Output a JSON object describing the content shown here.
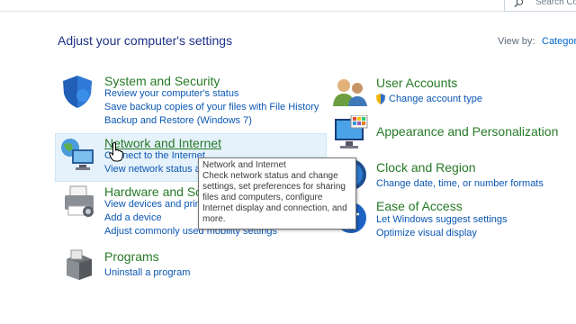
{
  "search": {
    "placeholder": "Search Co"
  },
  "header": {
    "title": "Adjust your computer's settings",
    "view_by_label": "View by:",
    "view_by_value": "Category"
  },
  "categories_left": [
    {
      "title": "System and Security",
      "icon": "shield-icon",
      "links": [
        "Review your computer's status",
        "Save backup copies of your files with File History",
        "Backup and Restore (Windows 7)"
      ]
    },
    {
      "title": "Network and Internet",
      "icon": "network-globe-icon",
      "links": [
        "Connect to the Internet",
        "View network status and tasks"
      ]
    },
    {
      "title": "Hardware and Sound",
      "icon": "printer-icon",
      "links": [
        "View devices and printers",
        "Add a device",
        "Adjust commonly used mobility settings"
      ]
    },
    {
      "title": "Programs",
      "icon": "programs-box-icon",
      "links": [
        "Uninstall a program"
      ]
    }
  ],
  "categories_right": [
    {
      "title": "User Accounts",
      "icon": "users-icon",
      "links": [
        "Change account type"
      ]
    },
    {
      "title": "Appearance and Personalization",
      "icon": "monitor-icon",
      "links": []
    },
    {
      "title": "Clock and Region",
      "icon": "clock-globe-icon",
      "links": [
        "Change date, time, or number formats"
      ]
    },
    {
      "title": "Ease of Access",
      "icon": "ease-of-access-icon",
      "links": [
        "Let Windows suggest settings",
        "Optimize visual display"
      ]
    }
  ],
  "tooltip": {
    "title": "Network and Internet",
    "lines": [
      "Check network status and change",
      "settings, set preferences for sharing",
      "files and computers, configure",
      "Internet display and connection, and",
      "more."
    ]
  },
  "colors": {
    "title_green": "#267a26",
    "link_blue": "#0a57b3",
    "heading_blue": "#1e3287",
    "hover_bg": "#e6f2fb"
  }
}
